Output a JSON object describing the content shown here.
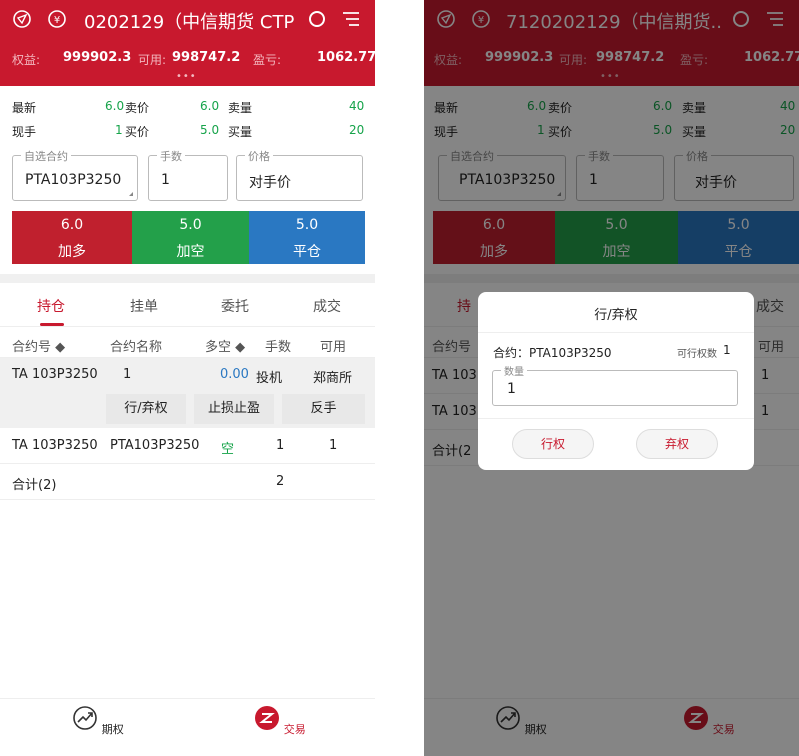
{
  "colors": {
    "brand_red": "#c8192e",
    "buy_red": "#c0202e",
    "sell_green": "#23a04a",
    "close_blue": "#2a78c2",
    "price_green": "#16a34a"
  },
  "left": {
    "header": {
      "title": "0202129（中信期货 CTP"
    },
    "account": {
      "equity_label": "权益:",
      "equity_value": "999902.3",
      "available_label": "可用:",
      "available_value": "998747.2",
      "pnl_label": "盈亏:",
      "pnl_value": "1062.77",
      "dots": "•••"
    },
    "quotes": {
      "latest_label": "最新",
      "latest_value": "6.0",
      "ask_label": "卖价",
      "ask_value": "6.0",
      "ask_qty_label": "卖量",
      "ask_qty_value": "40",
      "hand_label": "现手",
      "hand_value": "1",
      "bid_label": "买价",
      "bid_value": "5.0",
      "bid_qty_label": "买量",
      "bid_qty_value": "20"
    },
    "order_form": {
      "contract_legend": "自选合约",
      "contract_value": "PTA103P3250",
      "lots_legend": "手数",
      "lots_value": "1",
      "price_legend": "价格",
      "price_value": "对手价"
    },
    "order_buttons": [
      {
        "price": "6.0",
        "label": "加多"
      },
      {
        "price": "5.0",
        "label": "加空"
      },
      {
        "price": "5.0",
        "label": "平仓"
      }
    ],
    "tabs": [
      "持仓",
      "挂单",
      "委托",
      "成交"
    ],
    "table": {
      "headers": [
        "合约号 ◆",
        "合约名称",
        "多空 ◆",
        "手数",
        "可用"
      ],
      "row1": [
        "TA 103P3250",
        "1",
        "0.00",
        "投机",
        "郑商所"
      ],
      "actions": [
        "行/弃权",
        "止损止盈",
        "反手"
      ],
      "row2": [
        "TA 103P3250",
        "PTA103P3250",
        "空",
        "1",
        "1"
      ],
      "total": [
        "合计(2)",
        "2"
      ]
    },
    "bottom_nav": [
      {
        "label": "期权",
        "icon": "trend-icon"
      },
      {
        "label": "交易",
        "icon": "trade-icon"
      }
    ]
  },
  "right": {
    "header": {
      "title": "7120202129（中信期货.."
    },
    "account": {
      "equity_label": "权益:",
      "equity_value": "999902.3",
      "available_label": "可用:",
      "available_value": "998747.2",
      "pnl_label": "盈亏:",
      "pnl_value": "1062.77",
      "dots": "•••"
    },
    "quotes": {
      "latest_label": "最新",
      "latest_value": "6.0",
      "ask_label": "卖价",
      "ask_value": "6.0",
      "ask_qty_label": "卖量",
      "ask_qty_value": "40",
      "hand_label": "现手",
      "hand_value": "1",
      "bid_label": "买价",
      "bid_value": "5.0",
      "bid_qty_label": "买量",
      "bid_qty_value": "20"
    },
    "order_form": {
      "contract_legend": "自选合约",
      "contract_value": "PTA103P3250",
      "lots_legend": "手数",
      "lots_value": "1",
      "price_legend": "价格",
      "price_value": "对手价"
    },
    "order_buttons": [
      {
        "price": "6.0",
        "label": "加多"
      },
      {
        "price": "5.0",
        "label": "加空"
      },
      {
        "price": "5.0",
        "label": "平仓"
      }
    ],
    "tabs_visible": [
      "持",
      "成交"
    ],
    "table": {
      "header_left": "合约号",
      "header_right": "可用",
      "row1_left": "TA 103",
      "row1_right": "1",
      "row2_left": "TA 103",
      "row2_right": "1",
      "total_left": "合计(2"
    },
    "dialog": {
      "title": "行/弃权",
      "contract_label": "合约：PTA103P3250",
      "exercisable_label": "可行权数",
      "exercisable_value": "1",
      "qty_legend": "数量",
      "qty_value": "1",
      "exercise_button": "行权",
      "abandon_button": "弃权"
    },
    "bottom_nav": [
      {
        "label": "期权",
        "icon": "trend-icon"
      },
      {
        "label": "交易",
        "icon": "trade-icon"
      }
    ]
  }
}
